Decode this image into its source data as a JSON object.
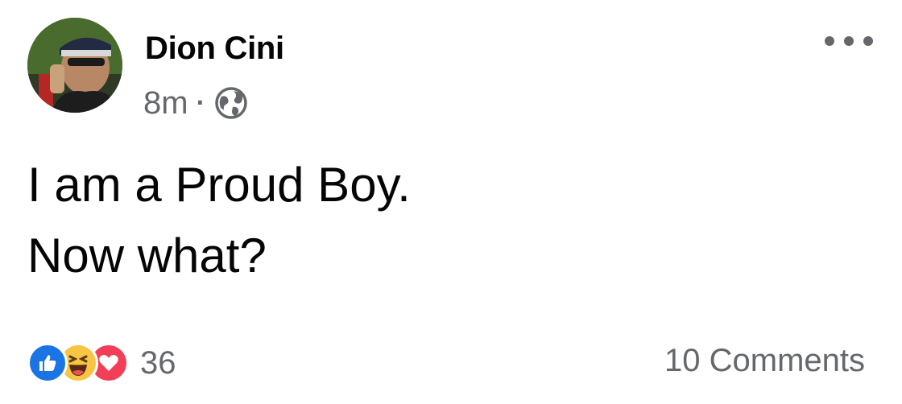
{
  "post": {
    "author": {
      "name": "Dion Cini",
      "avatar_icon": "profile-photo"
    },
    "timestamp": "8m",
    "separator": "·",
    "audience_icon": "globe-icon",
    "more_icon": "ellipsis-icon",
    "text_lines": [
      "I am a Proud Boy.",
      "Now what?"
    ],
    "reactions": {
      "icons": [
        "like-icon",
        "haha-icon",
        "love-icon"
      ],
      "count": "36"
    },
    "comments_label": "10 Comments"
  },
  "colors": {
    "text_primary": "#050505",
    "text_secondary": "#65676b",
    "like_blue": "#1b74e4",
    "haha_yellow": "#f7c543",
    "love_red": "#f33e58"
  }
}
